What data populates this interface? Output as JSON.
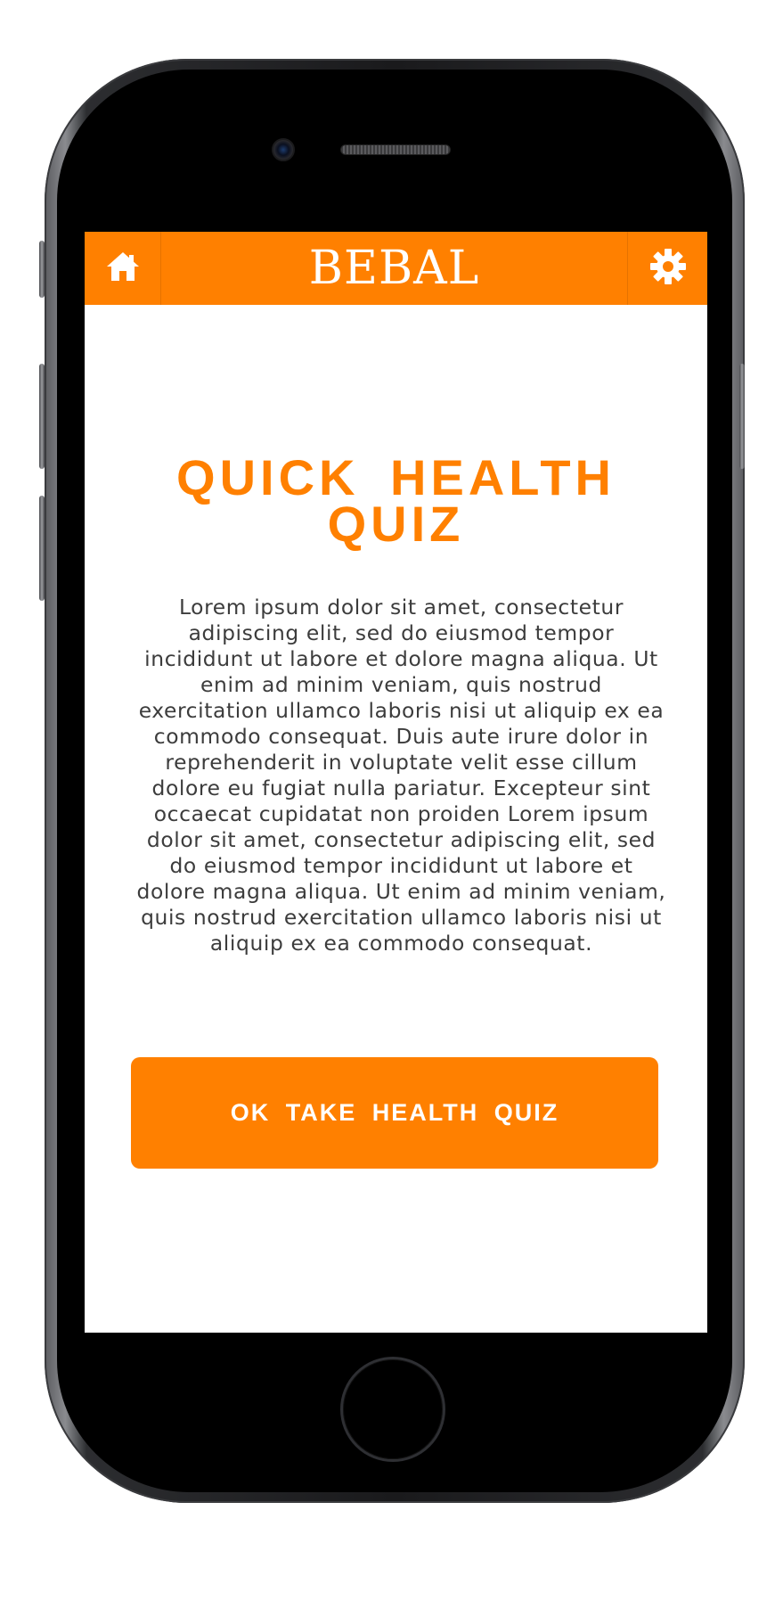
{
  "app": {
    "brand": "BEBAL"
  },
  "header": {
    "home_icon": "home-icon",
    "settings_icon": "gear-icon"
  },
  "main": {
    "title": "QUICK HEALTH QUIZ",
    "body": "Lorem ipsum dolor sit amet, consectetur adipiscing elit, sed do eiusmod tempor incididunt ut labore et dolore magna aliqua. Ut enim ad minim veniam, quis nostrud exercitation ullamco laboris nisi ut aliquip ex ea commodo consequat. Duis aute irure dolor in reprehenderit in voluptate velit esse cillum dolore eu fugiat nulla pariatur. Excepteur sint occaecat cupidatat non proiden Lorem ipsum dolor sit amet, consectetur adipiscing elit, sed do eiusmod tempor incididunt ut labore et dolore magna aliqua. Ut enim ad minim veniam, quis nostrud exercitation ullamco laboris nisi ut aliquip ex ea commodo consequat.",
    "cta_label": "OK TAKE HEALTH QUIZ"
  },
  "colors": {
    "accent": "#ff8000",
    "text": "#3c3c3c",
    "device": "#000000"
  }
}
